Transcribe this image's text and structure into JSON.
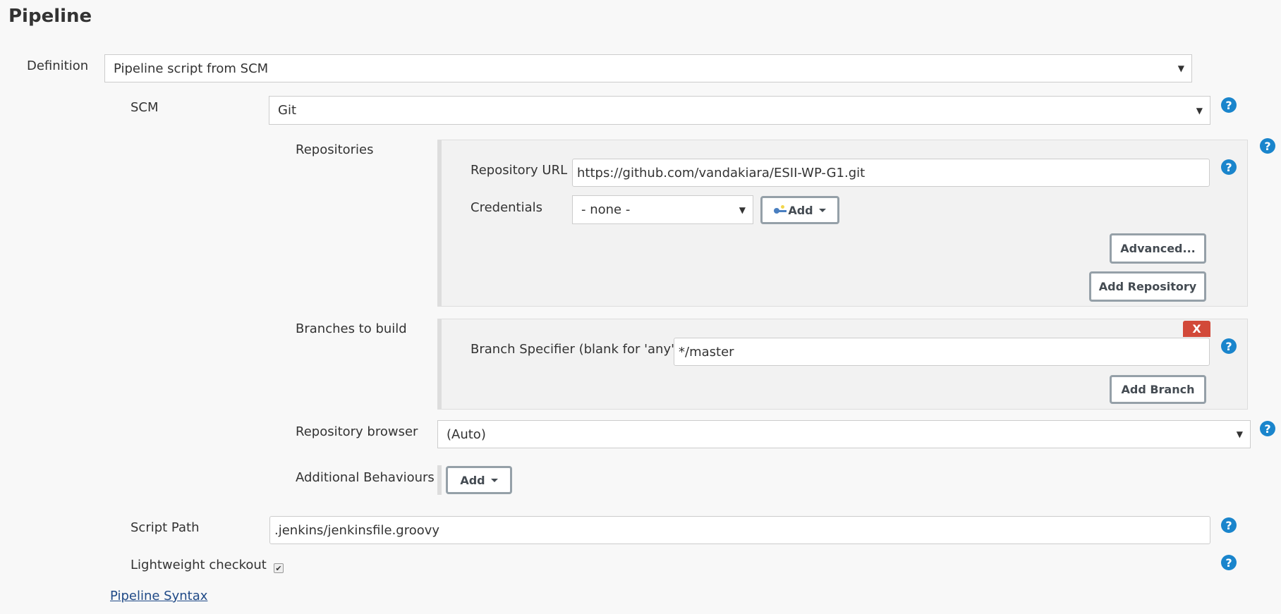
{
  "section_title": "Pipeline",
  "definition": {
    "label": "Definition",
    "selected": "Pipeline script from SCM"
  },
  "scm": {
    "label": "SCM",
    "selected": "Git"
  },
  "repositories": {
    "label": "Repositories",
    "url_label": "Repository URL",
    "url_value": "https://github.com/vandakiara/ESII-WP-G1.git",
    "credentials_label": "Credentials",
    "credentials_selected": "- none -",
    "add_credentials_label": "Add",
    "advanced_label": "Advanced...",
    "add_repository_label": "Add Repository"
  },
  "branches": {
    "label": "Branches to build",
    "specifier_label": "Branch Specifier (blank for 'any')",
    "specifier_value": "*/master",
    "delete_label": "X",
    "add_branch_label": "Add Branch"
  },
  "repository_browser": {
    "label": "Repository browser",
    "selected": "(Auto)"
  },
  "additional_behaviours": {
    "label": "Additional Behaviours",
    "add_label": "Add"
  },
  "script_path": {
    "label": "Script Path",
    "value": ".jenkins/jenkinsfile.groovy"
  },
  "lightweight_checkout": {
    "label": "Lightweight checkout",
    "checked": true,
    "check_glyph": "✔"
  },
  "pipeline_syntax_link": "Pipeline Syntax",
  "icons": {
    "help": "?",
    "dropdown_arrow": "▼"
  },
  "colors": {
    "help_icon": "#1a85cc",
    "delete_button": "#d24939",
    "link": "#204a87"
  }
}
